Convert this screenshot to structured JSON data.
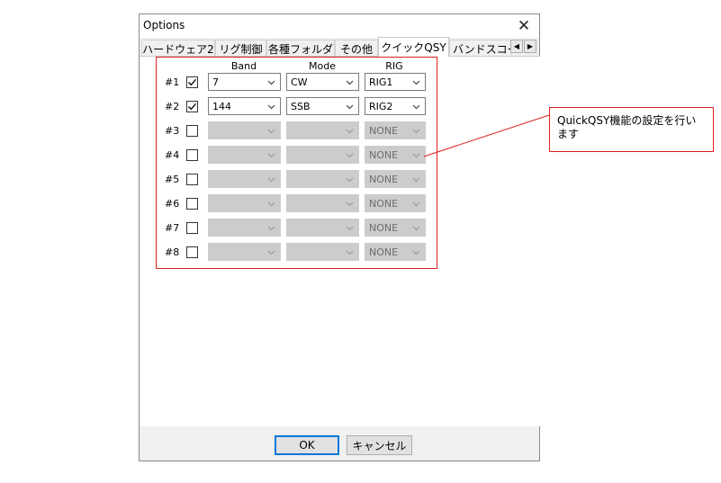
{
  "dialog": {
    "title": "Options",
    "close_glyph": "✕"
  },
  "tabs": [
    {
      "label": "ハードウェア2",
      "active": false
    },
    {
      "label": "リグ制御",
      "active": false
    },
    {
      "label": "各種フォルダ",
      "active": false
    },
    {
      "label": "その他",
      "active": false
    },
    {
      "label": "クイックQSY",
      "active": true
    },
    {
      "label": "バンドスコー",
      "active": false
    }
  ],
  "tab_scroll": {
    "left_glyph": "◀",
    "right_glyph": "▶"
  },
  "table": {
    "headers": {
      "band": "Band",
      "mode": "Mode",
      "rig": "RIG"
    },
    "rows": [
      {
        "label": "#1",
        "checked": true,
        "band": "7",
        "mode": "CW",
        "rig": "RIG1",
        "enabled": true
      },
      {
        "label": "#2",
        "checked": true,
        "band": "144",
        "mode": "SSB",
        "rig": "RIG2",
        "enabled": true
      },
      {
        "label": "#3",
        "checked": false,
        "band": "",
        "mode": "",
        "rig": "NONE",
        "enabled": false
      },
      {
        "label": "#4",
        "checked": false,
        "band": "",
        "mode": "",
        "rig": "NONE",
        "enabled": false
      },
      {
        "label": "#5",
        "checked": false,
        "band": "",
        "mode": "",
        "rig": "NONE",
        "enabled": false
      },
      {
        "label": "#6",
        "checked": false,
        "band": "",
        "mode": "",
        "rig": "NONE",
        "enabled": false
      },
      {
        "label": "#7",
        "checked": false,
        "band": "",
        "mode": "",
        "rig": "NONE",
        "enabled": false
      },
      {
        "label": "#8",
        "checked": false,
        "band": "",
        "mode": "",
        "rig": "NONE",
        "enabled": false
      }
    ]
  },
  "buttons": {
    "ok": "OK",
    "cancel": "キャンセル"
  },
  "annotation": {
    "text": "QuickQSY機能の設定を行います"
  },
  "colors": {
    "highlight": "#e02020",
    "focus": "#0078d7"
  }
}
